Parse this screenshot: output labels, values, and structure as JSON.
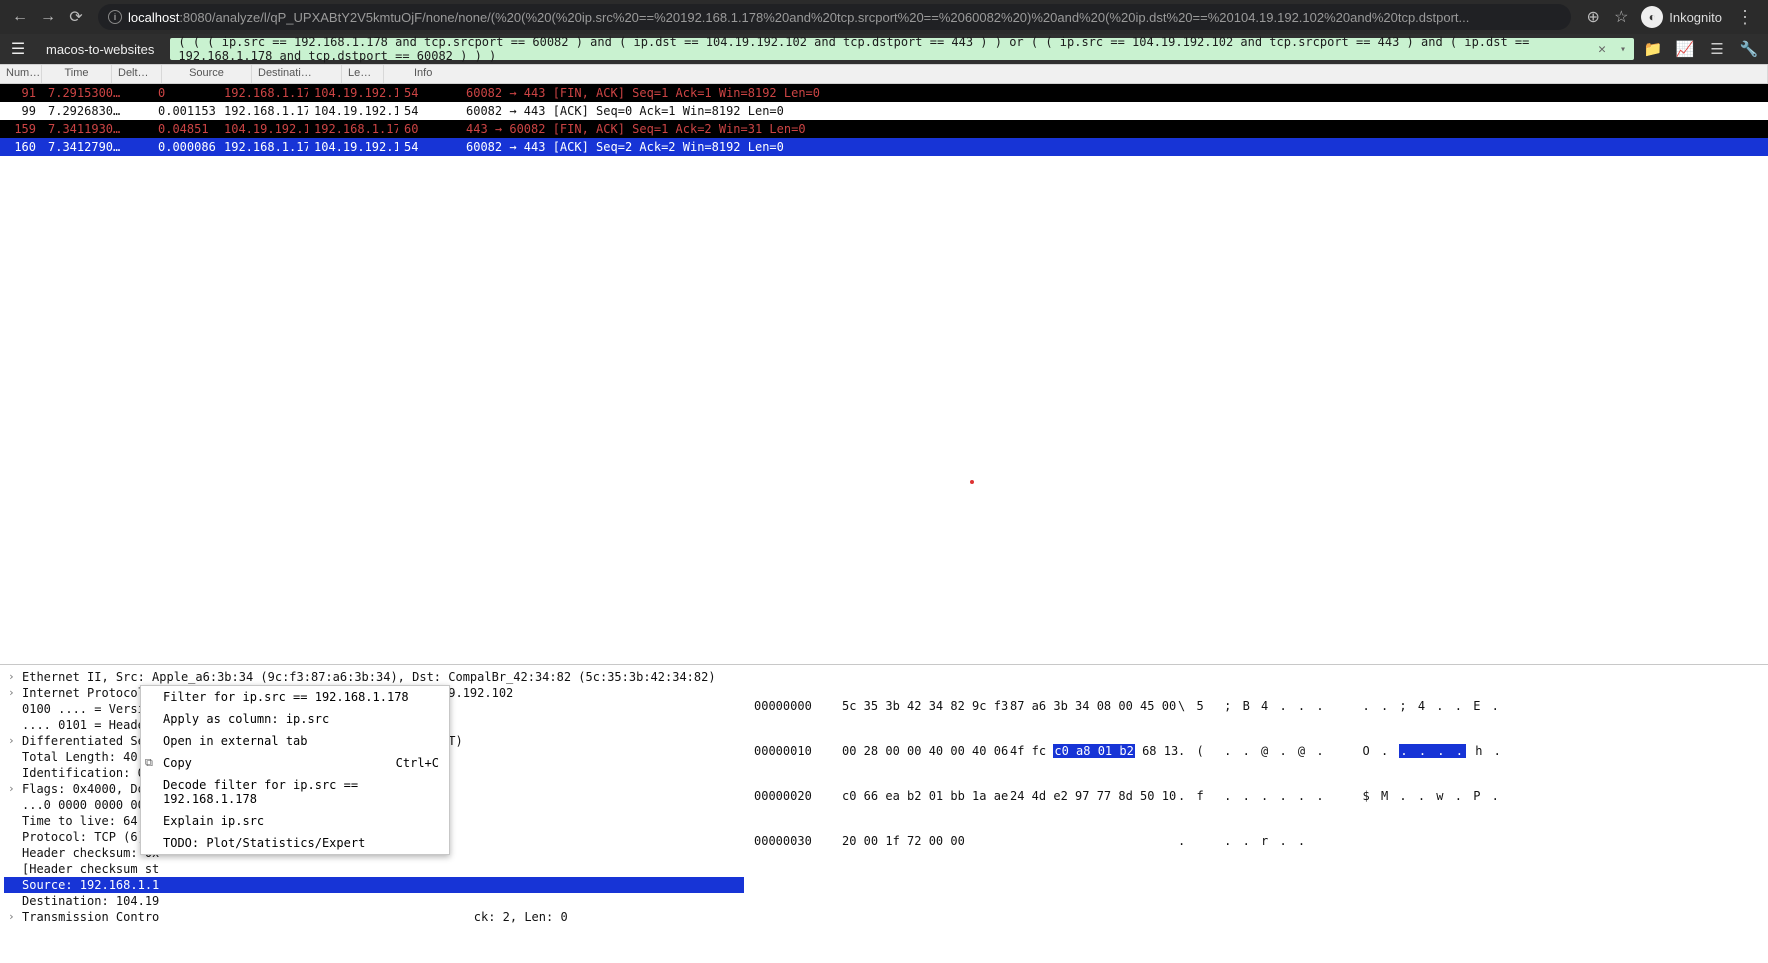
{
  "browser": {
    "host": "localhost",
    "port_path": ":8080/analyze/l/qP_UPXABtY2V5kmtuOjF/none/none/(%20(%20(%20ip.src%20==%20192.168.1.178%20and%20tcp.srcport%20==%2060082%20)%20and%20(%20ip.dst%20==%20104.19.192.102%20and%20tcp.dstport...",
    "profile": "Inkognito"
  },
  "app": {
    "title": "macos-to-websites",
    "filter": "( ( ( ip.src == 192.168.1.178 and tcp.srcport == 60082 ) and ( ip.dst == 104.19.192.102 and tcp.dstport == 443 ) ) or ( ( ip.src == 104.19.192.102 and tcp.srcport == 443 ) and ( ip.dst == 192.168.1.178 and tcp.dstport == 60082 ) ) )"
  },
  "cols": {
    "num": "Num…",
    "time": "Time",
    "delta": "Delt…",
    "src": "Source",
    "dst": "Destinati…",
    "len": "Le…",
    "info": "Info"
  },
  "packets": [
    {
      "num": "91",
      "time": "7.2915300…",
      "delta": "0",
      "src": "192.168.1.178",
      "dst": "104.19.192.102",
      "len": "54",
      "info": "60082 → 443 [FIN, ACK] Seq=1 Ack=1 Win=8192 Len=0",
      "style": "dark"
    },
    {
      "num": "99",
      "time": "7.2926830…",
      "delta": "0.001153",
      "src": "192.168.1.178",
      "dst": "104.19.192.102",
      "len": "54",
      "info": "60082 → 443 [ACK] Seq=0 Ack=1 Win=8192 Len=0",
      "style": "normal"
    },
    {
      "num": "159",
      "time": "7.3411930…",
      "delta": "0.04851",
      "src": "104.19.192.102",
      "dst": "192.168.1.178",
      "len": "60",
      "info": "443 → 60082 [FIN, ACK] Seq=1 Ack=2 Win=31 Len=0",
      "style": "dark"
    },
    {
      "num": "160",
      "time": "7.3412790…",
      "delta": "0.000086",
      "src": "192.168.1.178",
      "dst": "104.19.192.102",
      "len": "54",
      "info": "60082 → 443 [ACK] Seq=2 Ack=2 Win=8192 Len=0",
      "style": "selected"
    }
  ],
  "tree": {
    "l0": "Ethernet II, Src: Apple_a6:3b:34 (9c:f3:87:a6:3b:34), Dst: CompalBr_42:34:82 (5c:35:3b:42:34:82)",
    "l1": "Internet Protocol Version 4, Src: 192.168.1.178, Dst: 104.19.192.102",
    "l2": "0100 .... = Version: 4",
    "l3": ".... 0101 = Header Length: 20 bytes (5)",
    "l4": "Differentiated Services Field: 0x00 (DSCP: CS0, ECN: Not-ECT)",
    "l5": "Total Length: 40",
    "l6": "Identification: 0x0000 (0)",
    "l7": "Flags: 0x4000, Don't fragment",
    "l8": "...0 0000 0000 0000 = Fragment offset: 0",
    "l9": "Time to live: 64",
    "l10": "Protocol: TCP (6)",
    "l11": "Header checksum: 0x",
    "l12": "[Header checksum st",
    "l13": "Source: 192.168.1.1",
    "l14": "Destination: 104.19",
    "l15": "Transmission Contro",
    "l15tail": "ck: 2, Len: 0"
  },
  "ctx": {
    "i0": "Filter for ip.src == 192.168.1.178",
    "i1": "Apply as column: ip.src",
    "i2": "Open in external tab",
    "i3": "Copy",
    "i3s": "Ctrl+C",
    "i4": "Decode filter for ip.src == 192.168.1.178",
    "i5": "Explain ip.src",
    "i6": "TODO: Plot/Statistics/Expert"
  },
  "hex": {
    "r0": {
      "off": "00000000",
      "b1": "5c 35 3b 42 34 82 9c f3",
      "b2": "87 a6 3b 34 08 00 45 00",
      "a": "\\ 5  ; B 4 . . .    . . ; 4 . . E ."
    },
    "r1": {
      "off": "00000010",
      "b1": "00 28 00 00 40 00 40 06",
      "b2a": "4f fc ",
      "b2h": "c0 a8 01 b2",
      "b2b": " 68 13",
      "a1": ". (  . . @ . @ .    O . ",
      "ah": ". . . .",
      "a2": " h ."
    },
    "r2": {
      "off": "00000020",
      "b1": "c0 66 ea b2 01 bb 1a ae",
      "b2": "24 4d e2 97 77 8d 50 10",
      "a": ". f  . . . . . .    $ M . . w . P ."
    },
    "r3": {
      "off": "00000030",
      "b1": "20 00 1f 72 00 00",
      "b2": "",
      "a": ".    . . r . ."
    }
  }
}
